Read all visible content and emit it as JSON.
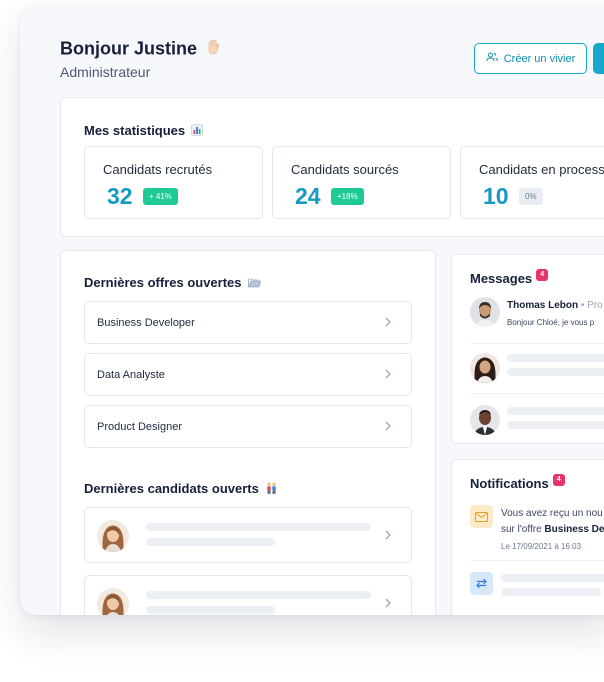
{
  "header": {
    "greeting": "Bonjour Justine",
    "role": "Administrateur",
    "create_button": "Créer un vivier"
  },
  "stats": {
    "title": "Mes statistiques",
    "items": [
      {
        "label": "Candidats recrutés",
        "value": "32",
        "badge": "+ 41%"
      },
      {
        "label": "Candidats sourcés",
        "value": "24",
        "badge": "+18%"
      },
      {
        "label": "Candidats en process",
        "value": "10",
        "badge": "0%"
      }
    ]
  },
  "offers": {
    "title": "Dernières offres ouvertes",
    "items": [
      "Business Developer",
      "Data Analyste",
      "Product Designer"
    ]
  },
  "candidates": {
    "title": "Dernières candidats ouverts"
  },
  "messages": {
    "title": "Messages",
    "count": "4",
    "first": {
      "name": "Thomas Lebon",
      "meta": "• Pro",
      "text": "Bonjour Chloé, je vous p"
    }
  },
  "notifications": {
    "title": "Notifications",
    "count": "4",
    "first": {
      "text": "Vous avez reçu un nou",
      "text2": "sur l'offre ",
      "offer": "Business De",
      "date": "Le 17/09/2021 à 16:03"
    }
  },
  "colors": {
    "accent": "#15a8c8",
    "stat_value": "#1499c2",
    "badge_green": "#1ec995",
    "badge_pink": "#e8336d"
  }
}
